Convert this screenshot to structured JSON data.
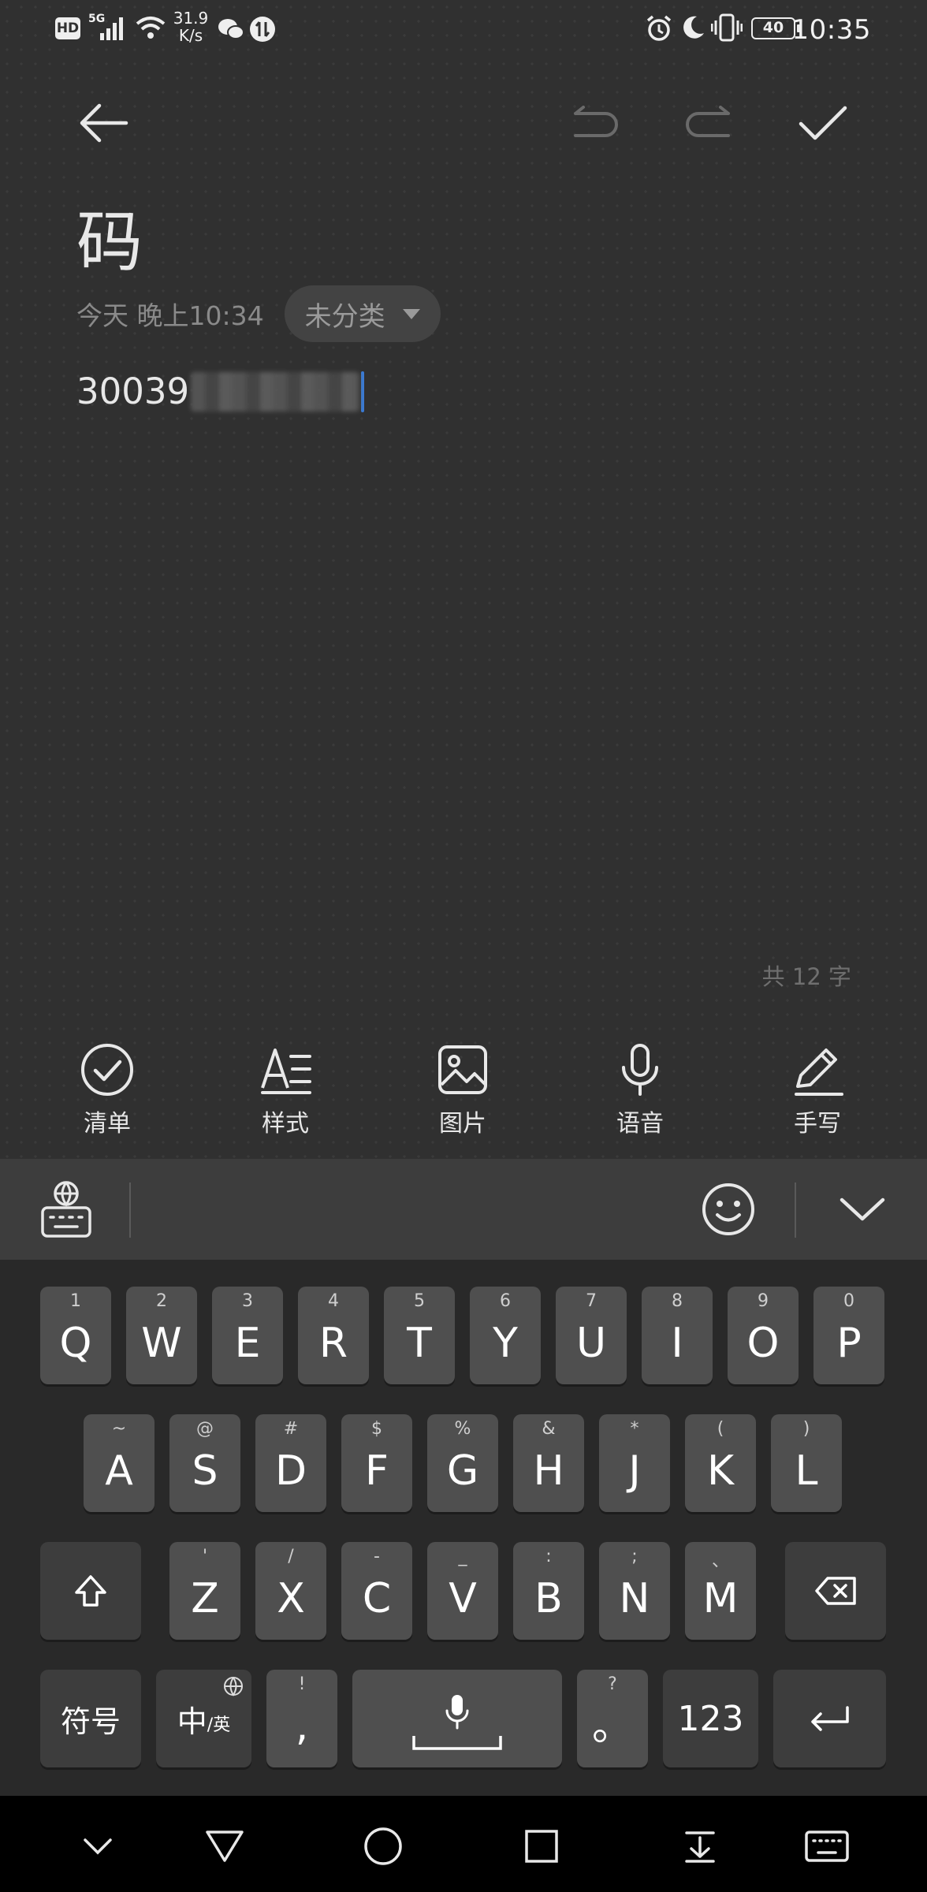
{
  "status_bar": {
    "hd": "HD",
    "network": "5G",
    "speed_value": "31.9",
    "speed_unit": "K/s",
    "battery": "40",
    "time": "10:35"
  },
  "note": {
    "title": "码",
    "date": "今天 晚上10:34",
    "category": "未分类",
    "body_visible": "30039",
    "word_count": "共 12 字"
  },
  "tools": [
    {
      "label": "清单",
      "icon": "checklist-icon"
    },
    {
      "label": "样式",
      "icon": "text-style-icon"
    },
    {
      "label": "图片",
      "icon": "image-icon"
    },
    {
      "label": "语音",
      "icon": "microphone-icon"
    },
    {
      "label": "手写",
      "icon": "pen-icon"
    }
  ],
  "keyboard": {
    "row1": [
      {
        "main": "Q",
        "hint": "1"
      },
      {
        "main": "W",
        "hint": "2"
      },
      {
        "main": "E",
        "hint": "3"
      },
      {
        "main": "R",
        "hint": "4"
      },
      {
        "main": "T",
        "hint": "5"
      },
      {
        "main": "Y",
        "hint": "6"
      },
      {
        "main": "U",
        "hint": "7"
      },
      {
        "main": "I",
        "hint": "8"
      },
      {
        "main": "O",
        "hint": "9"
      },
      {
        "main": "P",
        "hint": "0"
      }
    ],
    "row2": [
      {
        "main": "A",
        "hint": "~"
      },
      {
        "main": "S",
        "hint": "@"
      },
      {
        "main": "D",
        "hint": "#"
      },
      {
        "main": "F",
        "hint": "$"
      },
      {
        "main": "G",
        "hint": "%"
      },
      {
        "main": "H",
        "hint": "&"
      },
      {
        "main": "J",
        "hint": "*"
      },
      {
        "main": "K",
        "hint": "("
      },
      {
        "main": "L",
        "hint": ")"
      }
    ],
    "row3": [
      {
        "main": "Z",
        "hint": "'"
      },
      {
        "main": "X",
        "hint": "/"
      },
      {
        "main": "C",
        "hint": "-"
      },
      {
        "main": "V",
        "hint": "_"
      },
      {
        "main": "B",
        "hint": ":"
      },
      {
        "main": "N",
        "hint": ";"
      },
      {
        "main": "M",
        "hint": "、"
      }
    ],
    "symbols": "符号",
    "lang_main": "中",
    "lang_sub": "/英",
    "comma": ",",
    "comma_hint": "!",
    "period": "。",
    "period_hint": "?",
    "numbers": "123"
  },
  "colors": {
    "note_bg": "#303030",
    "keyboard_bg": "#292929",
    "key_bg": "#4f4f4f",
    "caret": "#3a7bd5"
  }
}
